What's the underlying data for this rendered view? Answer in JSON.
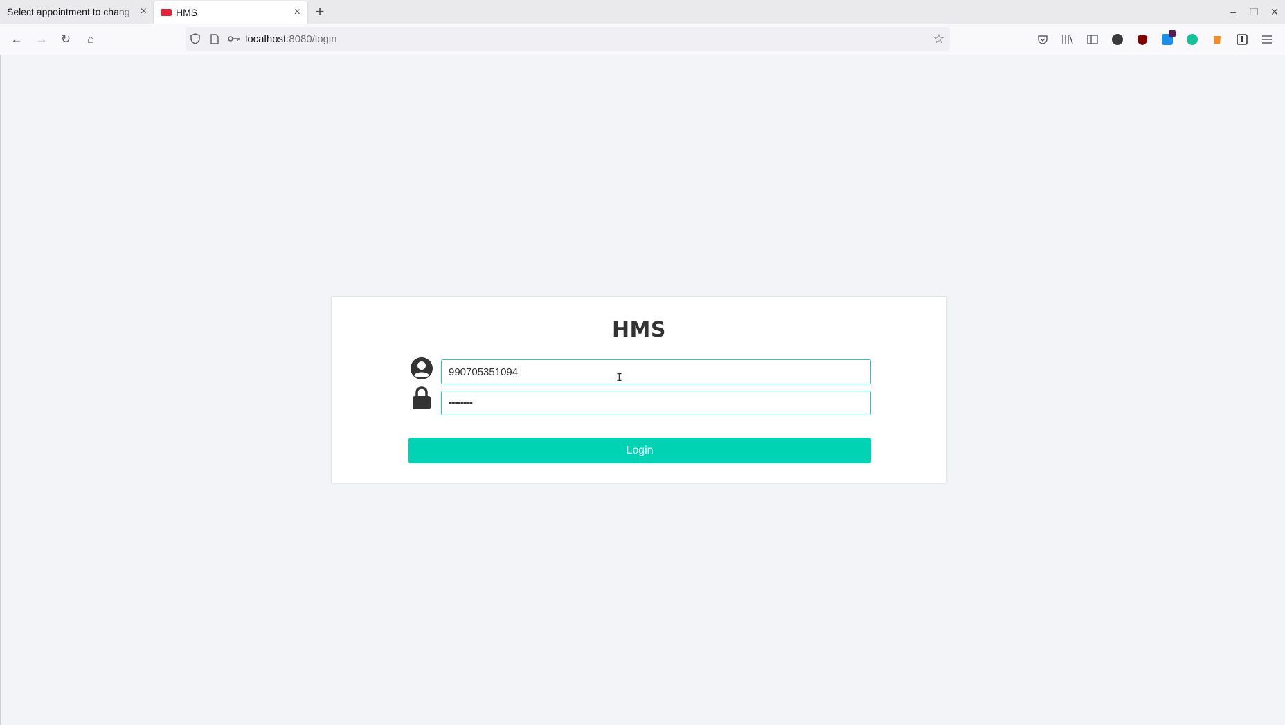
{
  "browser": {
    "tabs": [
      {
        "title": "Select appointment to chang",
        "close": "×",
        "active": false
      },
      {
        "title": "HMS",
        "close": "×",
        "active": true
      }
    ],
    "new_tab": "+",
    "window_controls": {
      "minimize": "–",
      "restore": "❐",
      "close": "✕"
    },
    "url": {
      "host": "localhost",
      "path": ":8080/login"
    },
    "nav_icons": {
      "back": "←",
      "forward": "→",
      "reload": "↻",
      "home": "⌂"
    },
    "toolbar_icons": [
      {
        "name": "pocket-icon",
        "color": "#5b5b66"
      },
      {
        "name": "library-icon",
        "color": "#5b5b66"
      },
      {
        "name": "sidebar-icon",
        "color": "#5b5b66"
      },
      {
        "name": "extension-t-icon",
        "color": "#3a3a3a"
      },
      {
        "name": "ublock-icon",
        "color": "#800000"
      },
      {
        "name": "extension-badge-icon",
        "color": "#1a8fe8"
      },
      {
        "name": "grammarly-icon",
        "color": "#15c39a"
      },
      {
        "name": "extension-orange-icon",
        "color": "#f28c28"
      },
      {
        "name": "bitwarden-icon",
        "color": "#3a3a3a"
      },
      {
        "name": "menu-icon",
        "color": "#5b5b66"
      }
    ]
  },
  "login": {
    "title": "HMS",
    "username_value": "990705351094",
    "password_value": "••••••••",
    "button_label": "Login"
  },
  "colors": {
    "accent": "#00d2b4",
    "input_border": "#22cdb1",
    "page_bg": "#f2f4f8"
  }
}
